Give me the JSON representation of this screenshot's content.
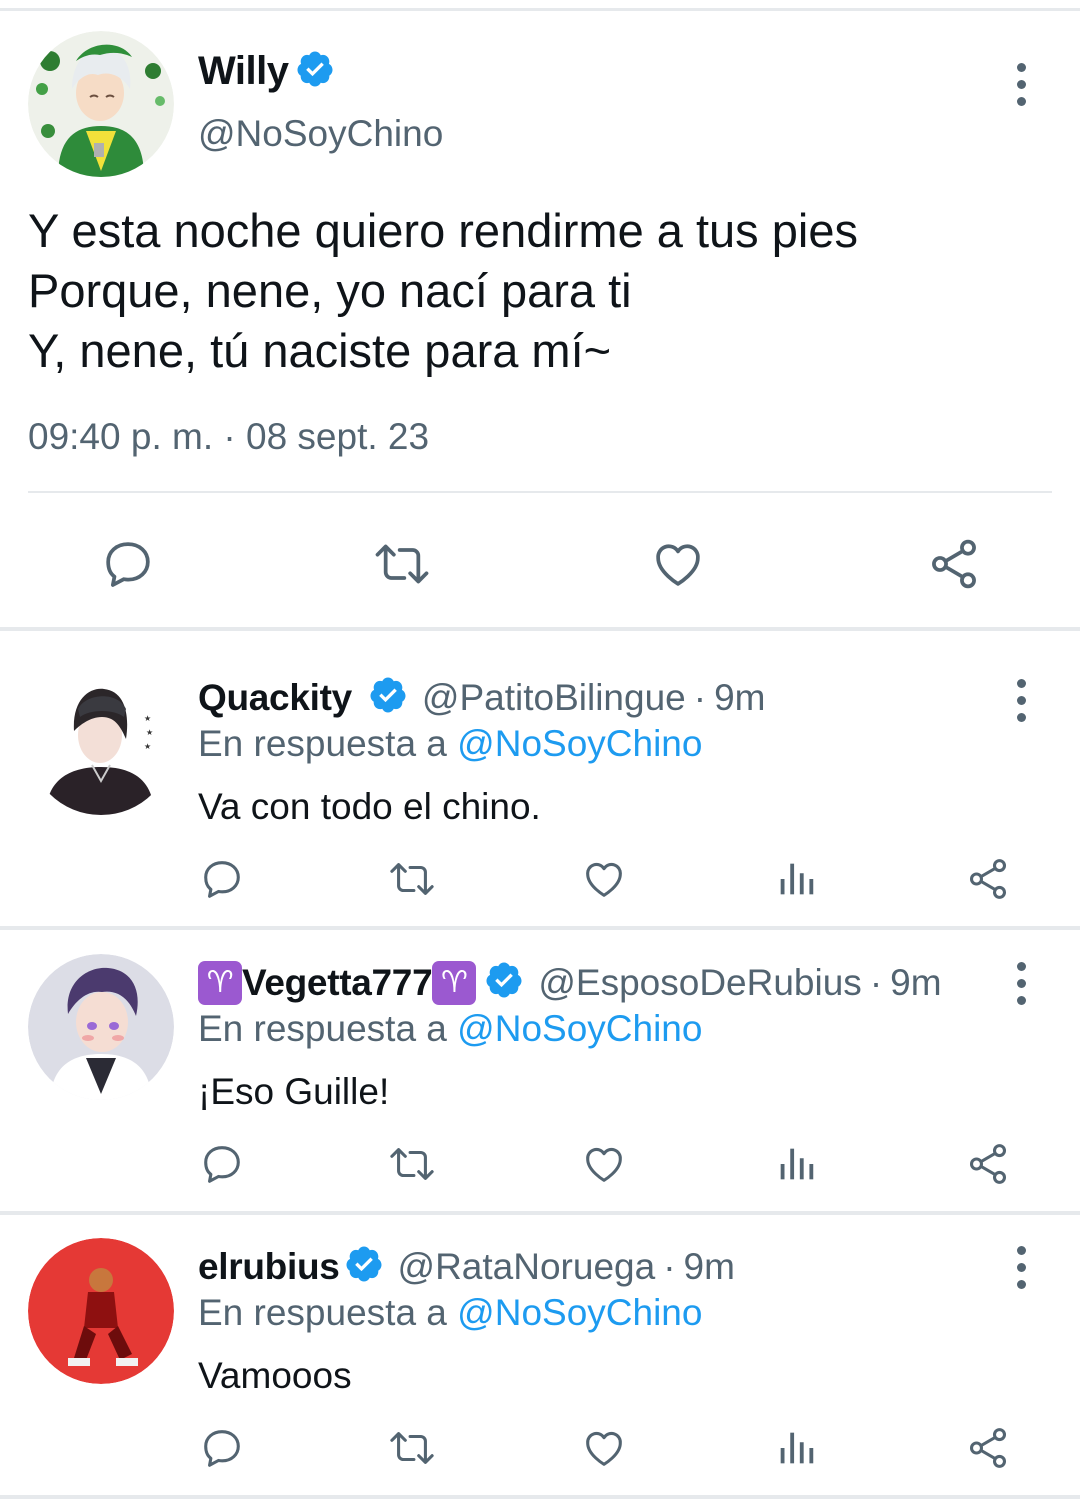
{
  "main_tweet": {
    "name": "Willy",
    "handle": "@NoSoyChino",
    "lines": [
      "Y esta noche quiero rendirme a tus pies",
      "Porque, nene, yo nací para ti",
      "Y, nene, tú naciste para mí~"
    ],
    "timestamp": "09:40 p. m. · 08 sept. 23",
    "actions": [
      "reply-icon",
      "retweet-icon",
      "like-icon",
      "share-icon"
    ]
  },
  "replies": [
    {
      "name": "Quackity",
      "handle": "@PatitoBilingue",
      "age": "9m",
      "in_reply_prefix": "En respuesta a",
      "in_reply_to": "@NoSoyChino",
      "body": "Va con todo el chino."
    },
    {
      "name_emoji": "♈",
      "name": "Vegetta777",
      "handle": "@EsposoDeRubius",
      "age": "9m",
      "in_reply_prefix": "En respuesta a",
      "in_reply_to": "@NoSoyChino",
      "body": "¡Eso Guille!"
    },
    {
      "name": "elrubius",
      "handle": "@RataNoruega",
      "age": "9m",
      "in_reply_prefix": "En respuesta a",
      "in_reply_to": "@NoSoyChino",
      "body": "Vamooos"
    }
  ],
  "separator_dot": "·",
  "colors": {
    "text": "#0f1419",
    "secondary": "#536471",
    "accent": "#1d9bf0",
    "divider": "#e6e9ec",
    "aries_badge": "#9b59d0"
  }
}
